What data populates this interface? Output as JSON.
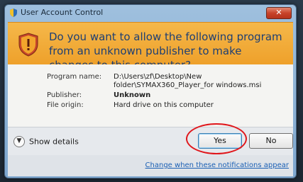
{
  "window": {
    "title": "User Account Control",
    "close_label": "✕"
  },
  "header": {
    "question": "Do you want to allow the following program from an unknown publisher to make changes to this computer?"
  },
  "details": {
    "program_name_label": "Program name:",
    "program_name_value": "D:\\Users\\zf\\Desktop\\New folder\\SYMAX360_Player_for windows.msi",
    "publisher_label": "Publisher:",
    "publisher_value": "Unknown",
    "file_origin_label": "File origin:",
    "file_origin_value": "Hard drive on this computer"
  },
  "footer": {
    "show_details_label": "Show details",
    "yes_label": "Yes",
    "no_label": "No",
    "change_link": "Change when these notifications appear"
  },
  "icons": {
    "title_icon": "uac-shield-icon",
    "header_icon": "warning-shield-icon",
    "show_details_icon": "chevron-down-icon"
  },
  "colors": {
    "header_orange": "#eea02a",
    "headline_blue": "#1e3f73",
    "annotation_red": "#e0161b",
    "link_blue": "#1a5fb4"
  }
}
